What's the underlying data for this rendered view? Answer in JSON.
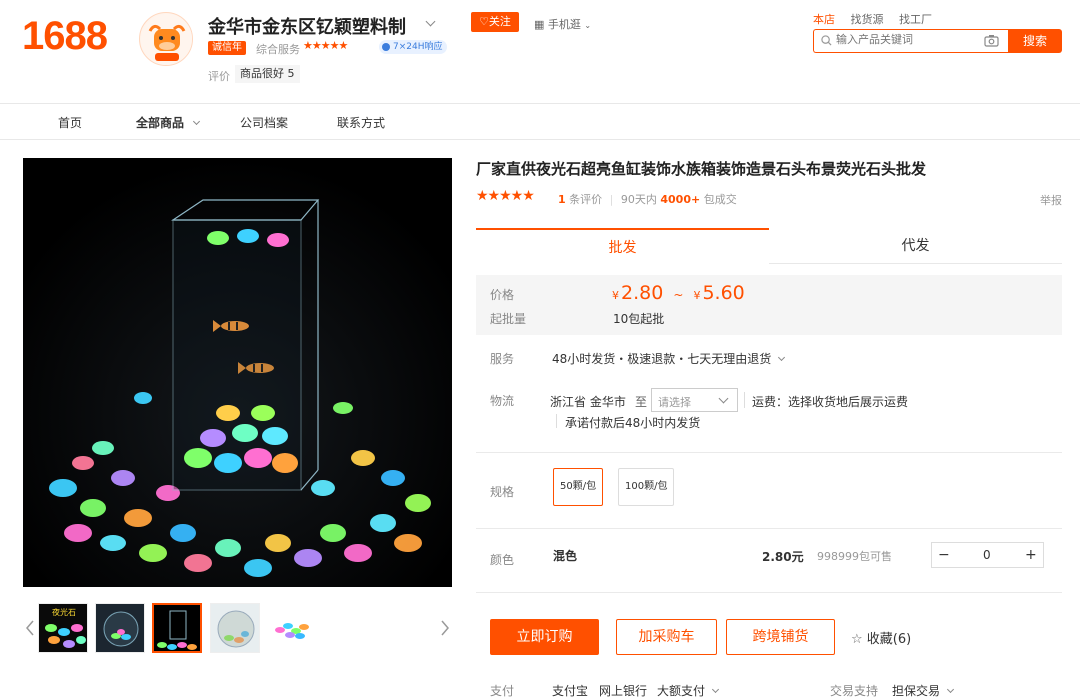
{
  "header": {
    "logo": "1688",
    "shop_name": "金华市金东区钇颖塑料制",
    "years_badge": "诚信年",
    "score_label": "综合服务",
    "score_stars": "★★★★★",
    "service_tag": "7×24H响应",
    "eval_label": "评价",
    "eval_tag": "商品很好 5",
    "follow_label": "♡关注",
    "mobile_label": "手机逛"
  },
  "search": {
    "tabs": [
      "本店",
      "找货源",
      "找工厂"
    ],
    "placeholder": "输入产品关键词",
    "button": "搜索"
  },
  "nav": {
    "items": [
      "首页",
      "全部商品",
      "公司档案",
      "联系方式"
    ]
  },
  "product": {
    "title": "厂家直供夜光石超亮鱼缸装饰水族箱装饰造景石头布景荧光石头批发",
    "rating_stars": "★★★★★",
    "review_count": "1",
    "review_suffix": "条评价",
    "sales_prefix": "90天内",
    "sales_count": "4000+",
    "sales_suffix": "包成交",
    "report": "举报",
    "thumb_label": "夜光石"
  },
  "tabs": {
    "wholesale": "批发",
    "dropship": "代发"
  },
  "pricing": {
    "price_label": "价格",
    "currency": "¥",
    "price_min": "2.80",
    "separator": "~",
    "price_max": "5.60",
    "moq_label": "起批量",
    "moq_value": "10包起批"
  },
  "service": {
    "label": "服务",
    "value": "48小时发货・极速退款・七天无理由退货"
  },
  "logistics": {
    "label": "物流",
    "origin": "浙江省 金华市",
    "to": "至",
    "select_placeholder": "请选择",
    "freight": "运费：选择收货地后展示运费",
    "promise": "承诺付款后48小时内发货"
  },
  "specs": {
    "label": "规格",
    "options": [
      "50颗/包",
      "100颗/包"
    ]
  },
  "color": {
    "label": "颜色",
    "value": "混色",
    "price": "2.80元",
    "stock": "998999包可售",
    "quantity": "0",
    "minus": "−",
    "plus": "+"
  },
  "actions": {
    "buy_now": "立即订购",
    "add_cart": "加采购车",
    "cross_border": "跨境铺货",
    "favorite": "收藏(6)"
  },
  "payment": {
    "label": "支付",
    "methods": [
      "支付宝",
      "网上银行",
      "大额支付"
    ],
    "trade_label": "交易支持",
    "trade_value": "担保交易"
  },
  "colors": {
    "accent": "#ff5000"
  }
}
